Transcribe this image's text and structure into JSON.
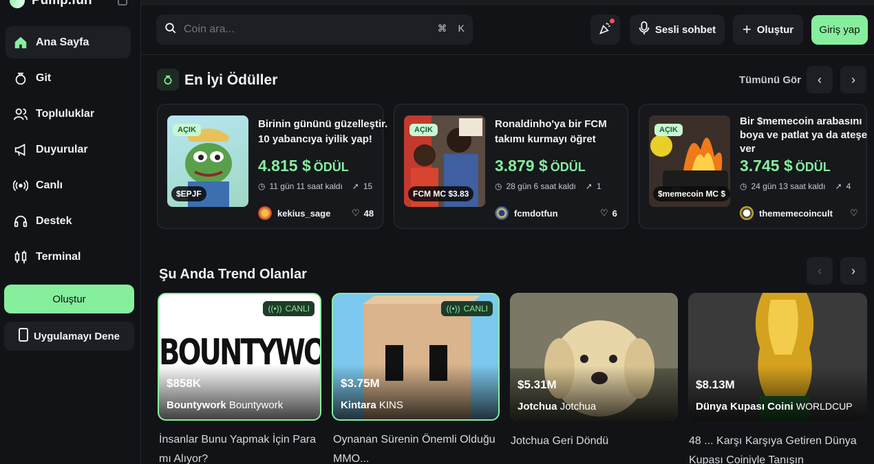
{
  "brand": {
    "name": "Pump.fun"
  },
  "sidebar": {
    "items": [
      {
        "label": "Ana Sayfa",
        "icon": "home-icon",
        "active": true
      },
      {
        "label": "Git",
        "icon": "bag-icon"
      },
      {
        "label": "Topluluklar",
        "icon": "users-icon"
      },
      {
        "label": "Duyurular",
        "icon": "megaphone-icon"
      },
      {
        "label": "Canlı",
        "icon": "broadcast-icon"
      },
      {
        "label": "Destek",
        "icon": "headset-icon"
      },
      {
        "label": "Terminal",
        "icon": "candles-icon"
      }
    ],
    "create_label": "Oluştur",
    "app_label": "Uygulamayı Dene"
  },
  "topbar": {
    "search_placeholder": "Coin ara...",
    "shortcut": [
      "⌘",
      "K"
    ],
    "voice_label": "Sesli sohbet",
    "create_label": "Oluştur",
    "login_label": "Giriş yap"
  },
  "bounties": {
    "title": "En İyi Ödüller",
    "see_all": "Tümünü Gör",
    "cards": [
      {
        "tag": "AÇIK",
        "ticker": "$EPJF",
        "title": "Birinin gününü güzelleştir. 10 yabancıya iyilik yap!",
        "amount": "4.815 $",
        "reward_label": "ÖDÜL",
        "time_left": "11 gün 11 saat kaldı",
        "submissions": "15",
        "user": "kekius_sage",
        "likes": "48"
      },
      {
        "tag": "AÇIK",
        "ticker": "FCM MC $3.83",
        "title": "Ronaldinho'ya bir FCM takımı kurmayı öğret",
        "amount": "3.879 $",
        "reward_label": "ÖDÜL",
        "time_left": "28 gün 6 saat kaldı",
        "submissions": "1",
        "user": "fcmdotfun",
        "likes": "6"
      },
      {
        "tag": "AÇIK",
        "ticker": "$memecoin MC $",
        "title": "Bir $memecoin arabasını boya ve patlat ya da ateşe ver",
        "amount": "3.745 $",
        "reward_label": "ÖDÜL",
        "time_left": "24 gün 13 saat kaldı",
        "submissions": "4",
        "user": "thememecoincult",
        "likes": ""
      }
    ]
  },
  "trending": {
    "title": "Şu Anda Trend Olanlar",
    "live_label": "CANLI",
    "cards": [
      {
        "mc": "$858K",
        "name": "Bountywork",
        "ticker": "Bountywork",
        "image_text": "BOUNTYWORK",
        "caption": "İnsanlar Bunu Yapmak İçin Para mı Alıyor?"
      },
      {
        "mc": "$3.75M",
        "name": "Kintara",
        "ticker": "KINS",
        "caption": "Oynanan Sürenin Önemli Olduğu MMO..."
      },
      {
        "mc": "$5.31M",
        "name": "Jotchua",
        "ticker": "Jotchua",
        "caption": "Jotchua Geri  Döndü"
      },
      {
        "mc": "$8.13M",
        "name": "Dünya Kupası Coini",
        "ticker": "WORLDCUP",
        "caption": "48 ... Karşı Karşıya Getiren Dünya Kupası Coiniyle Tanışın"
      }
    ]
  },
  "colors": {
    "accent": "#86ef9e",
    "background": "#111316",
    "card": "#16181c"
  }
}
